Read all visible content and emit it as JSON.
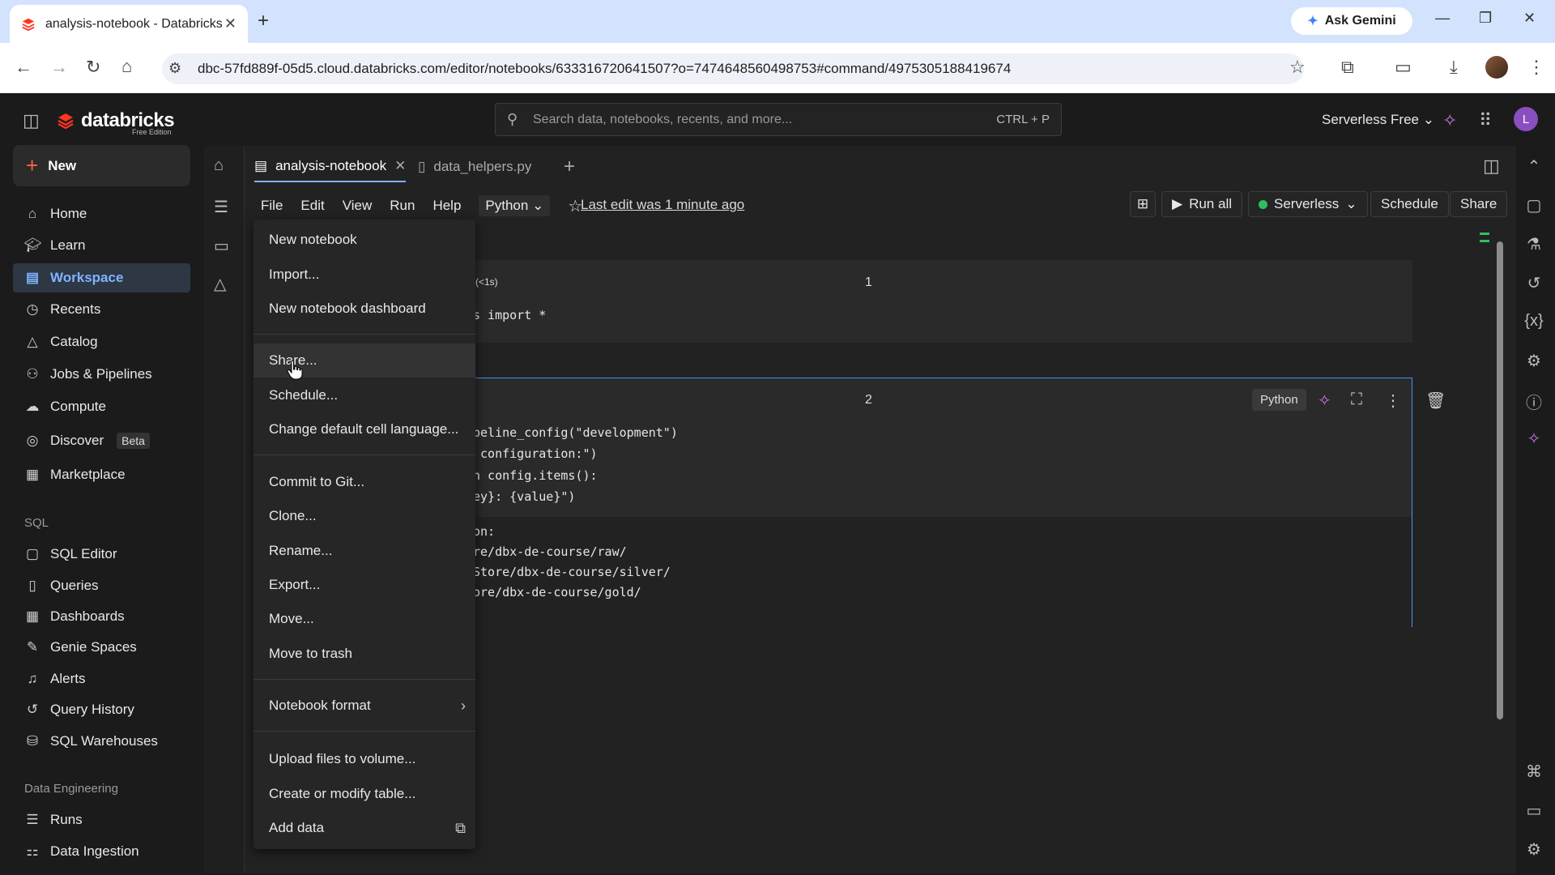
{
  "browser": {
    "tab_title": "analysis-notebook - Databricks",
    "url": "dbc-57fd889f-05d5.cloud.databricks.com/editor/notebooks/633316720641507?o=7474648560498753#command/4975305188419674",
    "ask_gemini": "Ask Gemini"
  },
  "app": {
    "logo": "databricks",
    "logo_sub": "Free Edition",
    "search_placeholder": "Search data, notebooks, recents, and more...",
    "search_shortcut": "CTRL + P",
    "workspace_switcher": "Serverless Free",
    "user_initial": "L"
  },
  "sidebar": {
    "new_label": "New",
    "items": [
      {
        "label": "Home",
        "icon": "home-icon"
      },
      {
        "label": "Learn",
        "icon": "learn-icon"
      },
      {
        "label": "Workspace",
        "icon": "workspace-icon",
        "active": true
      },
      {
        "label": "Recents",
        "icon": "clock-icon"
      },
      {
        "label": "Catalog",
        "icon": "catalog-icon"
      },
      {
        "label": "Jobs & Pipelines",
        "icon": "jobs-icon"
      },
      {
        "label": "Compute",
        "icon": "cloud-icon"
      },
      {
        "label": "Discover",
        "icon": "compass-icon",
        "badge": "Beta"
      },
      {
        "label": "Marketplace",
        "icon": "store-icon"
      }
    ],
    "sql_section": "SQL",
    "sql_items": [
      {
        "label": "SQL Editor"
      },
      {
        "label": "Queries"
      },
      {
        "label": "Dashboards"
      },
      {
        "label": "Genie Spaces"
      },
      {
        "label": "Alerts"
      },
      {
        "label": "Query History"
      },
      {
        "label": "SQL Warehouses"
      }
    ],
    "de_section": "Data Engineering",
    "de_items": [
      {
        "label": "Runs"
      },
      {
        "label": "Data Ingestion"
      }
    ]
  },
  "notebook": {
    "tabs": [
      {
        "label": "analysis-notebook",
        "active": true
      },
      {
        "label": "data_helpers.py",
        "active": false
      }
    ],
    "menu": [
      "File",
      "Edit",
      "View",
      "Run",
      "Help"
    ],
    "language": "Python",
    "last_edit": "Last edit was 1 minute ago",
    "run_all": "Run all",
    "compute": "Serverless",
    "schedule": "Schedule",
    "share": "Share"
  },
  "cells": [
    {
      "number": "1",
      "timing": "(<1s)",
      "code_lines": [
        "s import *"
      ]
    },
    {
      "number": "2",
      "language_tag": "Python",
      "code_lines": [
        "peline_config(\"development\")",
        " configuration:\")",
        "n config.items():",
        "ey}: {value}\")"
      ],
      "output_lines": [
        "on:",
        "re/dbx-de-course/raw/",
        "Store/dbx-de-course/silver/",
        "ore/dbx-de-course/gold/"
      ]
    }
  ],
  "file_menu": {
    "group1": [
      "New notebook",
      "Import...",
      "New notebook dashboard"
    ],
    "group2": [
      "Share...",
      "Schedule...",
      "Change default cell language..."
    ],
    "group3": [
      "Commit to Git...",
      "Clone...",
      "Rename...",
      "Export...",
      "Move...",
      "Move to trash"
    ],
    "group4": [
      "Notebook format"
    ],
    "group5": [
      "Upload files to volume...",
      "Create or modify table...",
      "Add data"
    ],
    "hovered": "Share..."
  }
}
